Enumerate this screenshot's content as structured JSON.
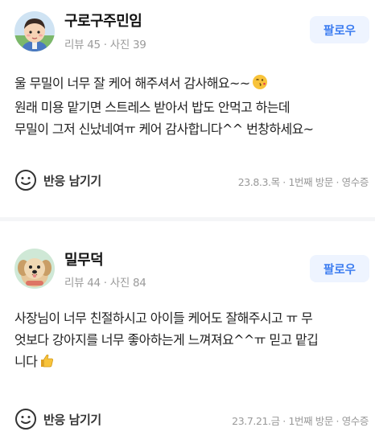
{
  "reviews": [
    {
      "author": "구로구주민임",
      "stats": "리뷰 45 · 사진 39",
      "follow_label": "팔로우",
      "text_lines": [
        "울 무밀이 너무 잘 케어 해주셔서 감사해요~~",
        "원래 미용 맡기면 스트레스 받아서 밥도 안먹고 하는데",
        "무밀이 그저 신났네여ㅠ 케어 감사합니다^^ 번창하세요~"
      ],
      "emoji": "kissing-face-emoji",
      "reaction_label": "반응 남기기",
      "visit_info": "23.8.3.목 · 1번째 방문 · 영수증"
    },
    {
      "author": "밀무덕",
      "stats": "리뷰 44 · 사진 84",
      "follow_label": "팔로우",
      "text_lines": [
        "사장님이 너무 친절하시고 아이들 케어도 잘해주시고 ㅠ 무",
        "엇보다 강아지를 너무 좋아하는게 느껴져요^^ㅠ 믿고 맡깁",
        "니다"
      ],
      "emoji": "thumbs-up-emoji",
      "reaction_label": "반응 남기기",
      "visit_info": "23.7.21.금 · 1번째 방문 · 영수증"
    }
  ]
}
